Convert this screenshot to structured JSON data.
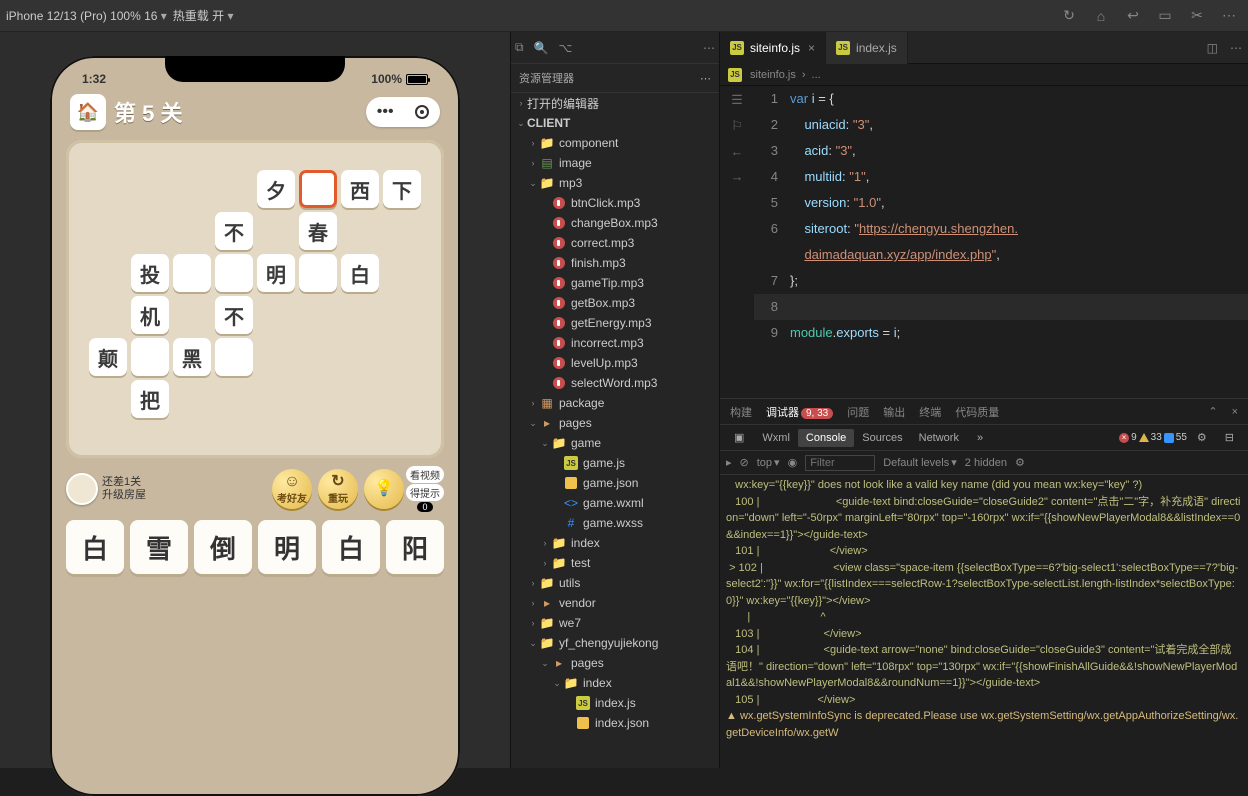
{
  "topbar": {
    "device": "iPhone 12/13 (Pro) 100% 16",
    "hotreload": "热重载 开"
  },
  "phone": {
    "time": "1:32",
    "battery": "100%",
    "level_prefix": "第",
    "level_num": "5",
    "level_suffix": "关",
    "grid": [
      [
        null,
        null,
        null,
        null,
        "夕",
        "",
        "西",
        "下"
      ],
      [
        null,
        null,
        null,
        "不",
        null,
        "春",
        null,
        null
      ],
      [
        null,
        "投",
        "",
        "",
        "明",
        "",
        "白",
        null
      ],
      [
        null,
        "机",
        null,
        "不",
        null,
        null,
        null,
        null
      ],
      [
        "颠",
        "",
        "黑",
        "",
        null,
        null,
        null,
        null
      ],
      [
        null,
        "把",
        null,
        null,
        null,
        null,
        null,
        null
      ]
    ],
    "active": {
      "r": 0,
      "c": 5
    },
    "house_line1": "还差1关",
    "house_line2": "升级房屋",
    "btn_friend": "考好友",
    "btn_replay": "重玩",
    "btn_hint_top": "看视频",
    "btn_hint_bot": "得提示",
    "hint_count": "0",
    "answers": [
      "白",
      "雪",
      "倒",
      "明",
      "白",
      "阳"
    ]
  },
  "explorer": {
    "title": "资源管理器",
    "openeditors": "打开的编辑器",
    "root": "CLIENT",
    "tree": [
      {
        "d": 1,
        "t": "folder",
        "c": false,
        "n": "component"
      },
      {
        "d": 1,
        "t": "img",
        "c": false,
        "n": "image"
      },
      {
        "d": 1,
        "t": "folder",
        "c": true,
        "n": "mp3"
      },
      {
        "d": 2,
        "t": "audio",
        "n": "btnClick.mp3"
      },
      {
        "d": 2,
        "t": "audio",
        "n": "changeBox.mp3"
      },
      {
        "d": 2,
        "t": "audio",
        "n": "correct.mp3"
      },
      {
        "d": 2,
        "t": "audio",
        "n": "finish.mp3"
      },
      {
        "d": 2,
        "t": "audio",
        "n": "gameTip.mp3"
      },
      {
        "d": 2,
        "t": "audio",
        "n": "getBox.mp3"
      },
      {
        "d": 2,
        "t": "audio",
        "n": "getEnergy.mp3"
      },
      {
        "d": 2,
        "t": "audio",
        "n": "incorrect.mp3"
      },
      {
        "d": 2,
        "t": "audio",
        "n": "levelUp.mp3"
      },
      {
        "d": 2,
        "t": "audio",
        "n": "selectWord.mp3"
      },
      {
        "d": 1,
        "t": "pkg",
        "c": false,
        "n": "package"
      },
      {
        "d": 1,
        "t": "orange",
        "c": true,
        "n": "pages"
      },
      {
        "d": 2,
        "t": "folder",
        "c": true,
        "n": "game"
      },
      {
        "d": 3,
        "t": "js",
        "n": "game.js"
      },
      {
        "d": 3,
        "t": "json",
        "n": "game.json"
      },
      {
        "d": 3,
        "t": "wxml",
        "n": "game.wxml"
      },
      {
        "d": 3,
        "t": "wxss",
        "n": "game.wxss"
      },
      {
        "d": 2,
        "t": "folder",
        "c": false,
        "n": "index"
      },
      {
        "d": 2,
        "t": "folder",
        "c": false,
        "n": "test"
      },
      {
        "d": 1,
        "t": "folder",
        "c": false,
        "n": "utils"
      },
      {
        "d": 1,
        "t": "orange",
        "c": false,
        "n": "vendor"
      },
      {
        "d": 1,
        "t": "folder",
        "c": false,
        "n": "we7"
      },
      {
        "d": 1,
        "t": "folder",
        "c": true,
        "n": "yf_chengyujiekong"
      },
      {
        "d": 2,
        "t": "orange",
        "c": true,
        "n": "pages"
      },
      {
        "d": 3,
        "t": "folder",
        "c": true,
        "n": "index"
      },
      {
        "d": 4,
        "t": "js",
        "n": "index.js"
      },
      {
        "d": 4,
        "t": "json",
        "n": "index.json"
      }
    ]
  },
  "tabs": {
    "active": "siteinfo.js",
    "other": "index.js"
  },
  "crumbs": {
    "file": "siteinfo.js",
    "more": "..."
  },
  "code": {
    "uniacid": "3",
    "acid": "3",
    "multiid": "1",
    "version": "1.0",
    "siteroot1": "https://chengyu.shengzhen.",
    "siteroot2": "daimadaquan.xyz/app/index.php"
  },
  "panel": {
    "tabs": [
      "构建",
      "调试器",
      "问题",
      "输出",
      "终端",
      "代码质量"
    ],
    "active": "调试器",
    "badge": "9, 33",
    "dev": [
      "Wxml",
      "Console",
      "Sources",
      "Network"
    ],
    "devActive": "Console",
    "errs": "9",
    "warns": "33",
    "info": "55",
    "top": "top",
    "filter_ph": "Filter",
    "levels": "Default levels",
    "hidden": "2 hidden"
  },
  "console": [
    "   wx:key=\"{{key}}\" does not look like a valid key name (did you mean wx:key=\"key\" ?)",
    "   100 |                         <guide-text bind:closeGuide=\"closeGuide2\" content=\"点击\"二\"字，补充成语\" direction=\"down\" left=\"-50rpx\" marginLeft=\"80rpx\" top=\"-160rpx\" wx:if=\"{{showNewPlayerModal8&&listIndex==0&&index==1}}\"></guide-text>",
    "   101 |                       </view>",
    " > 102 |                       <view class=\"space-item {{selectBoxType==6?'big-select1':selectBoxType==7?'big-select2':''}}\" wx:for=\"{{listIndex===selectRow-1?selectBoxType-selectList.length-listIndex*selectBoxType:0}}\" wx:key=\"{{key}}\"></view>",
    "       |                       ^",
    "   103 |                     </view>",
    "   104 |                     <guide-text arrow=\"none\" bind:closeGuide=\"closeGuide3\" content=\"试着完成全部成语吧！\" direction=\"down\" left=\"108rpx\" top=\"130rpx\" wx:if=\"{{showFinishAllGuide&&!showNewPlayerModal1&&!showNewPlayerModal8&&roundNum==1}}\"></guide-text>",
    "   105 |                   </view>",
    "▲ wx.getSystemInfoSync is deprecated.Please use wx.getSystemSetting/wx.getAppAuthorizeSetting/wx.getDeviceInfo/wx.getW"
  ]
}
